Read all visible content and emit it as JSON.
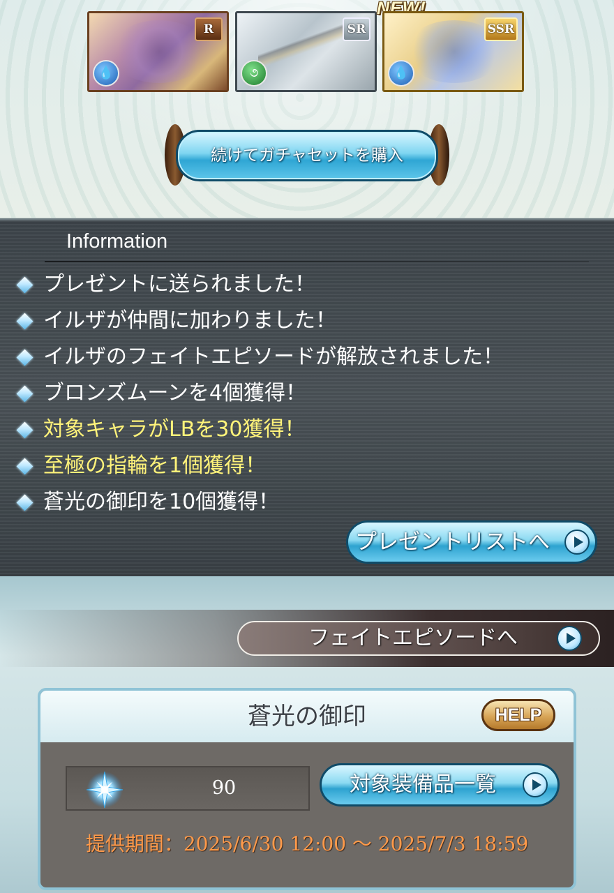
{
  "cards": [
    {
      "rarity": "R",
      "element": "water",
      "element_glyph": "💧",
      "type": "character"
    },
    {
      "rarity": "SR",
      "element": "wind",
      "element_glyph": "૭",
      "type": "weapon"
    },
    {
      "rarity": "SSR",
      "element": "water",
      "element_glyph": "💧",
      "type": "summon"
    }
  ],
  "new_badge": "NEW!",
  "continue_button": "続けてガチャセットを購入",
  "information": {
    "title": "Information",
    "items": [
      {
        "text": "プレゼントに送られました！",
        "highlight": false
      },
      {
        "text": "イルザが仲間に加わりました！",
        "highlight": false
      },
      {
        "text": "イルザのフェイトエピソードが解放されました！",
        "highlight": false
      },
      {
        "text": "ブロンズムーンを4個獲得！",
        "highlight": false
      },
      {
        "text": "対象キャラがLBを30獲得！",
        "highlight": true
      },
      {
        "text": "至極の指輪を1個獲得！",
        "highlight": true
      },
      {
        "text": "蒼光の御印を10個獲得！",
        "highlight": false
      }
    ],
    "present_list_button": "プレゼントリストへ"
  },
  "fate_episode_button": "フェイトエピソードへ",
  "seal_panel": {
    "title": "蒼光の御印",
    "help_button": "HELP",
    "count": "90",
    "equipment_list_button": "対象装備品一覧",
    "period": "提供期間：2025/6/30 12:00 ～ 2025/7/3 18:59"
  },
  "colors": {
    "highlight_text": "#fff37a",
    "period_text": "#ff9a4a",
    "button_blue": "#2ea3d0"
  }
}
